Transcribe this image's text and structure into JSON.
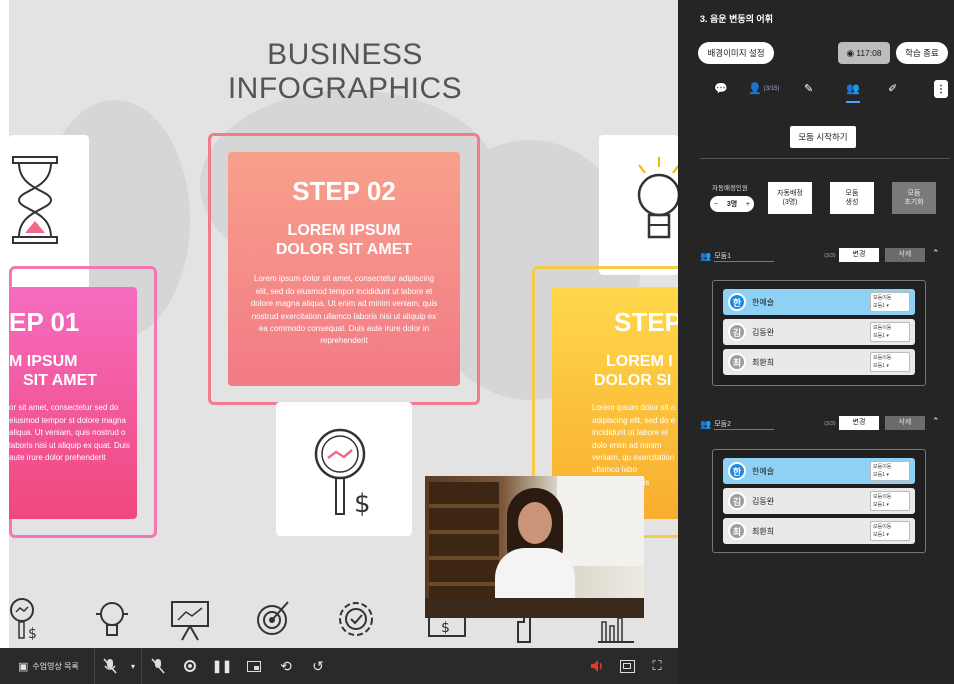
{
  "slide": {
    "title": "BUSINESS INFOGRAPHICS",
    "step1": {
      "step": "EP 01",
      "sub1": "M IPSUM",
      "sub2": "SIT AMET",
      "body": "or sit amet, consectetur sed do eiusmod tempor st dolore magna aliqua. Ut veniam, quis nostrud o laboris nisi ut aliquip ex quat. Duis aute irure dolor prehenderit"
    },
    "step2": {
      "step": "STEP 02",
      "sub1": "LOREM IPSUM",
      "sub2": "DOLOR SIT AMET",
      "body": "Lorem ipsum dolor sit amet, consectetur adipiscing elit, sed do eiusmod tempor incididunt ut labore et dolore magna aliqua. Ut enim ad minim veniam, quis nostrud exercitation ullamco laboris nisi ut aliquip ex ea commodo consequat. Duis aute irure dolor in reprehenderit"
    },
    "step3": {
      "step": "STEP",
      "sub1": "LOREM I",
      "sub2": "DOLOR SI",
      "body": "Lorem ipsum dolor sit a adipiscing elit, sed do e incididunt ut labore et dolo enim ad minim veniam, qu exercitation ullamco labo consequat. Duis reprehe"
    }
  },
  "bottombar": {
    "video_list": "수업영상 목록",
    "colors": {
      "bar": "#2a2a2a",
      "speaker": "#e53935"
    }
  },
  "panel": {
    "header": "3. 음운 변동의 어휘",
    "bg_image_button": "배경이미지 설정",
    "timer": "117:08",
    "end_button": "학습 종료",
    "participants_count": "(3/15)",
    "start_groups_button": "모둠 시작하기",
    "auto_assign_label": "자동배정인원",
    "auto_count": "3명",
    "auto_assign_button": "자동배정\n(3명)",
    "create_group_button": "모둠\n생성",
    "reset_group_button": "모둠\n초기화",
    "groups": [
      {
        "name": "모둠1",
        "count": "(3/3)",
        "change": "변경",
        "delete": "삭제",
        "members": [
          {
            "avatar": "한",
            "name": "한예슬",
            "sel_label": "모둠이동",
            "sel_value": "모둠1",
            "active": true
          },
          {
            "avatar": "김",
            "name": "김동완",
            "sel_label": "모둠이동",
            "sel_value": "모둠1",
            "active": false
          },
          {
            "avatar": "최",
            "name": "최환희",
            "sel_label": "모둠이동",
            "sel_value": "모둠1",
            "active": false
          }
        ]
      },
      {
        "name": "모둠2",
        "count": "(3/3)",
        "change": "변경",
        "delete": "삭제",
        "members": [
          {
            "avatar": "한",
            "name": "한예슬",
            "sel_label": "모둠이동",
            "sel_value": "모둠1",
            "active": true
          },
          {
            "avatar": "김",
            "name": "김동완",
            "sel_label": "모둠이동",
            "sel_value": "모둠1",
            "active": false
          },
          {
            "avatar": "최",
            "name": "최환희",
            "sel_label": "모둠이동",
            "sel_value": "모둠1",
            "active": false
          }
        ]
      }
    ],
    "colors": {
      "bg": "#252525",
      "active_member": "#8fd0f5",
      "member": "#e9e9e9",
      "delete_btn": "#6b6b6b"
    }
  }
}
